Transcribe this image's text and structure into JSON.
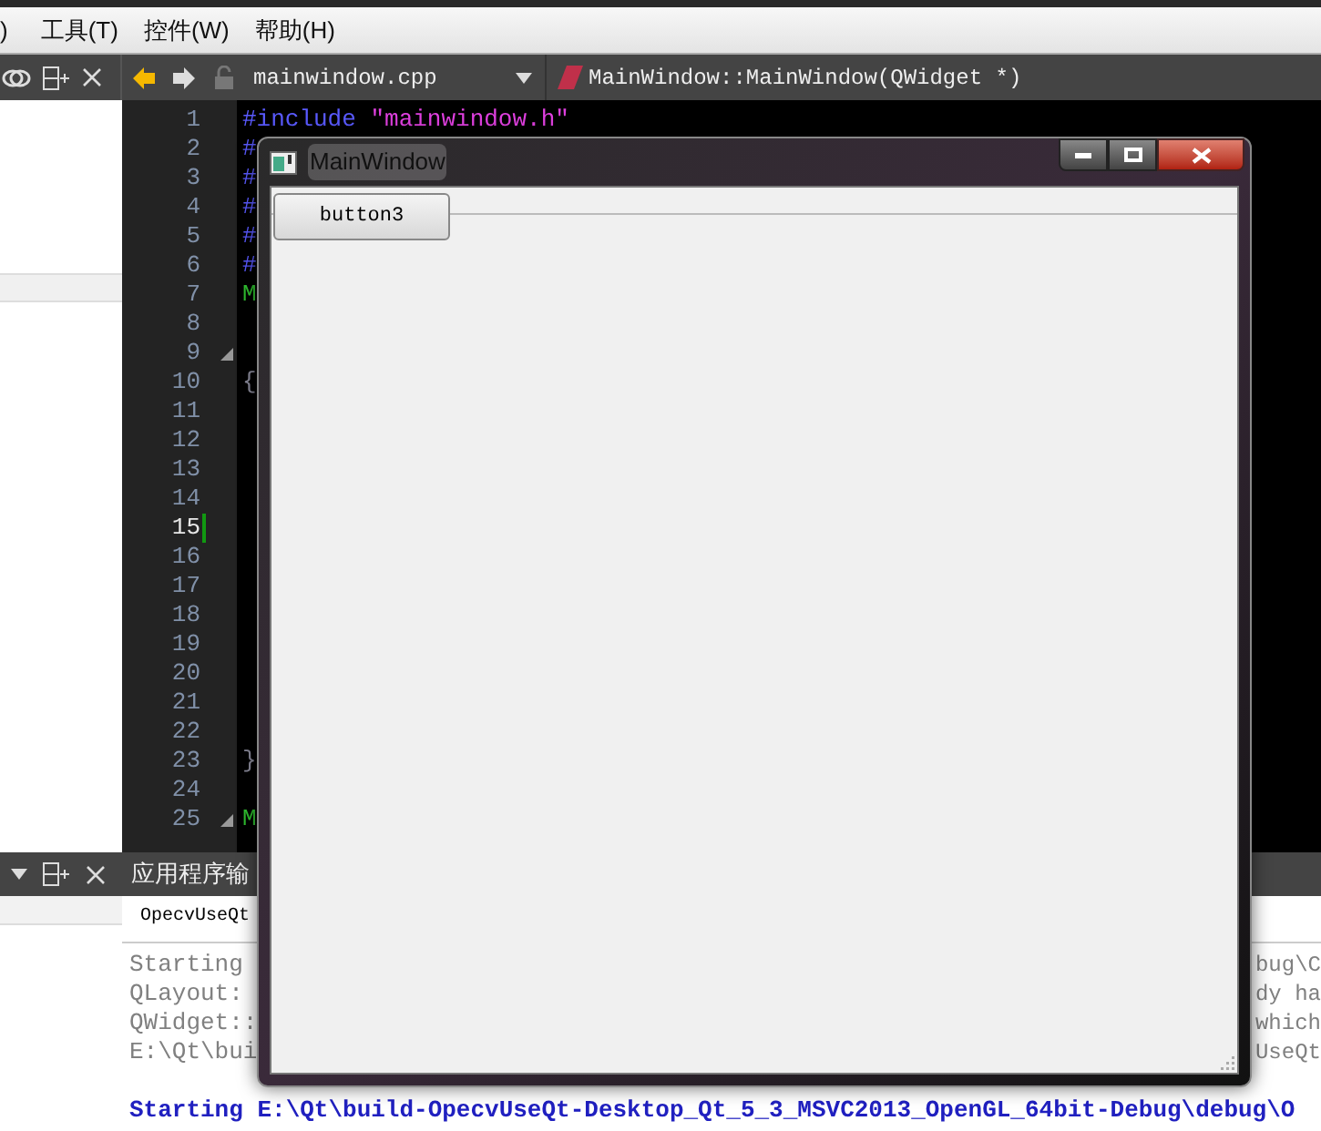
{
  "menu_bar": {
    "items": [
      {
        "label": ")"
      },
      {
        "label": "工具(T)"
      },
      {
        "label": "控件(W)"
      },
      {
        "label": "帮助(H)"
      }
    ]
  },
  "editor": {
    "file_name": "mainwindow.cpp",
    "symbol": "MainWindow::MainWindow(QWidget *)",
    "lines": [
      {
        "number": "1",
        "current": false,
        "fold": false,
        "tokens": [
          {
            "text": "#include",
            "kind": "directive"
          },
          {
            "text": " \"mainwindow.h\"",
            "kind": "string"
          }
        ]
      },
      {
        "number": "2",
        "current": false,
        "fold": false,
        "tokens": [
          {
            "text": "#",
            "kind": "directive"
          }
        ]
      },
      {
        "number": "3",
        "current": false,
        "fold": false,
        "tokens": [
          {
            "text": "#",
            "kind": "directive"
          }
        ]
      },
      {
        "number": "4",
        "current": false,
        "fold": false,
        "tokens": [
          {
            "text": "#",
            "kind": "directive"
          }
        ]
      },
      {
        "number": "5",
        "current": false,
        "fold": false,
        "tokens": [
          {
            "text": "#",
            "kind": "directive"
          }
        ]
      },
      {
        "number": "6",
        "current": false,
        "fold": false,
        "tokens": [
          {
            "text": "#",
            "kind": "directive"
          }
        ]
      },
      {
        "number": "7",
        "current": false,
        "fold": false,
        "tokens": [
          {
            "text": "M",
            "kind": "type"
          }
        ]
      },
      {
        "number": "8",
        "current": false,
        "fold": false
      },
      {
        "number": "9",
        "current": false,
        "fold": true
      },
      {
        "number": "10",
        "current": false,
        "fold": false,
        "tokens": [
          {
            "text": "{",
            "kind": "plain"
          }
        ]
      },
      {
        "number": "11",
        "current": false,
        "fold": false
      },
      {
        "number": "12",
        "current": false,
        "fold": false
      },
      {
        "number": "13",
        "current": false,
        "fold": false
      },
      {
        "number": "14",
        "current": false,
        "fold": false
      },
      {
        "number": "15",
        "current": true,
        "fold": false
      },
      {
        "number": "16",
        "current": false,
        "fold": false
      },
      {
        "number": "17",
        "current": false,
        "fold": false
      },
      {
        "number": "18",
        "current": false,
        "fold": false
      },
      {
        "number": "19",
        "current": false,
        "fold": false
      },
      {
        "number": "20",
        "current": false,
        "fold": false
      },
      {
        "number": "21",
        "current": false,
        "fold": false
      },
      {
        "number": "22",
        "current": false,
        "fold": false
      },
      {
        "number": "23",
        "current": false,
        "fold": false,
        "tokens": [
          {
            "text": "}",
            "kind": "plain"
          }
        ]
      },
      {
        "number": "24",
        "current": false,
        "fold": false
      },
      {
        "number": "25",
        "current": false,
        "fold": true,
        "tokens": [
          {
            "text": "M",
            "kind": "type"
          }
        ]
      }
    ]
  },
  "output_pane": {
    "title": "应用程序输",
    "tab": "OpecvUseQt",
    "lines": [
      {
        "left": "Starting",
        "right": "bug\\C",
        "kind": "normal"
      },
      {
        "left": "QLayout:",
        "right": "dy ha",
        "kind": "normal"
      },
      {
        "left": "QWidget::",
        "right": "which",
        "kind": "normal"
      },
      {
        "left": "E:\\Qt\\bui",
        "right": "UseQt",
        "kind": "normal"
      },
      {
        "kind": "blank"
      },
      {
        "left": "Starting E:\\Qt\\build-OpecvUseQt-Desktop_Qt_5_3_MSVC2013_OpenGL_64bit-Debug\\debug\\O",
        "kind": "info"
      }
    ]
  },
  "app_window": {
    "title": "MainWindow",
    "button": "button3"
  }
}
